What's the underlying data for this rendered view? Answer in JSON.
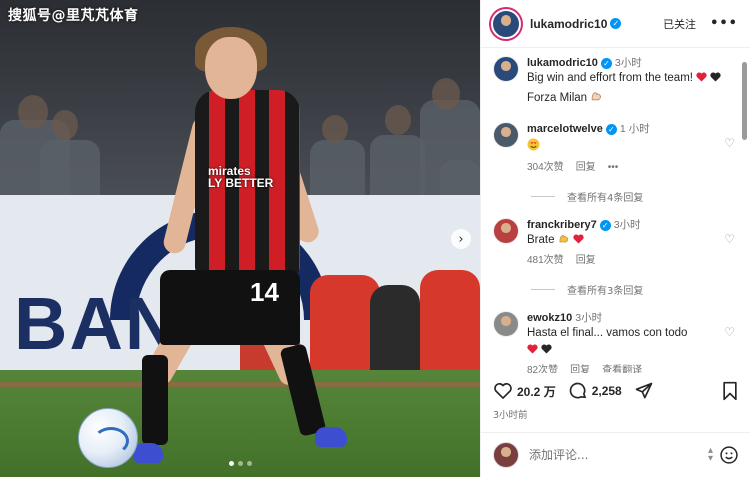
{
  "watermark": "搜狐号@里芃芃体育",
  "photo": {
    "jersey_sponsor_line1": "mirates",
    "jersey_sponsor_line2": "LY BETTER",
    "jersey_number": "14",
    "board_text": "BAN",
    "next_icon": "chevron-right-icon",
    "carousel_dots": 3,
    "active_dot": 1
  },
  "header": {
    "username": "lukamodric10",
    "verified_mark": "✓",
    "follow_status": "已关注",
    "more": "•••"
  },
  "caption": {
    "username": "lukamodric10",
    "time": "3小时",
    "line1": "Big win and effort from the team!",
    "line2": "Forza Milan"
  },
  "comments": [
    {
      "username": "marcelotwelve",
      "time": "1 小时",
      "likes": "304次赞",
      "reply": "回复",
      "more": "•••"
    },
    {
      "username": "franckribery7",
      "time": "3小时",
      "text": "Brate",
      "likes": "481次赞",
      "reply": "回复"
    },
    {
      "username": "ewokz10",
      "time": "3小时",
      "text": "Hasta el final... vamos con todo",
      "likes": "82次赞",
      "reply": "回复",
      "more": "查看翻译"
    }
  ],
  "view_replies": [
    "查看所有4条回复",
    "查看所有3条回复"
  ],
  "actions": {
    "likes": "20.2 万",
    "comments": "2,258",
    "posted": "3小时前"
  },
  "comment_box": {
    "placeholder": "添加评论..."
  },
  "colors": {
    "verified": "#0095f6",
    "heart_red": "#e0223a",
    "accent_ring": "#d62976"
  }
}
